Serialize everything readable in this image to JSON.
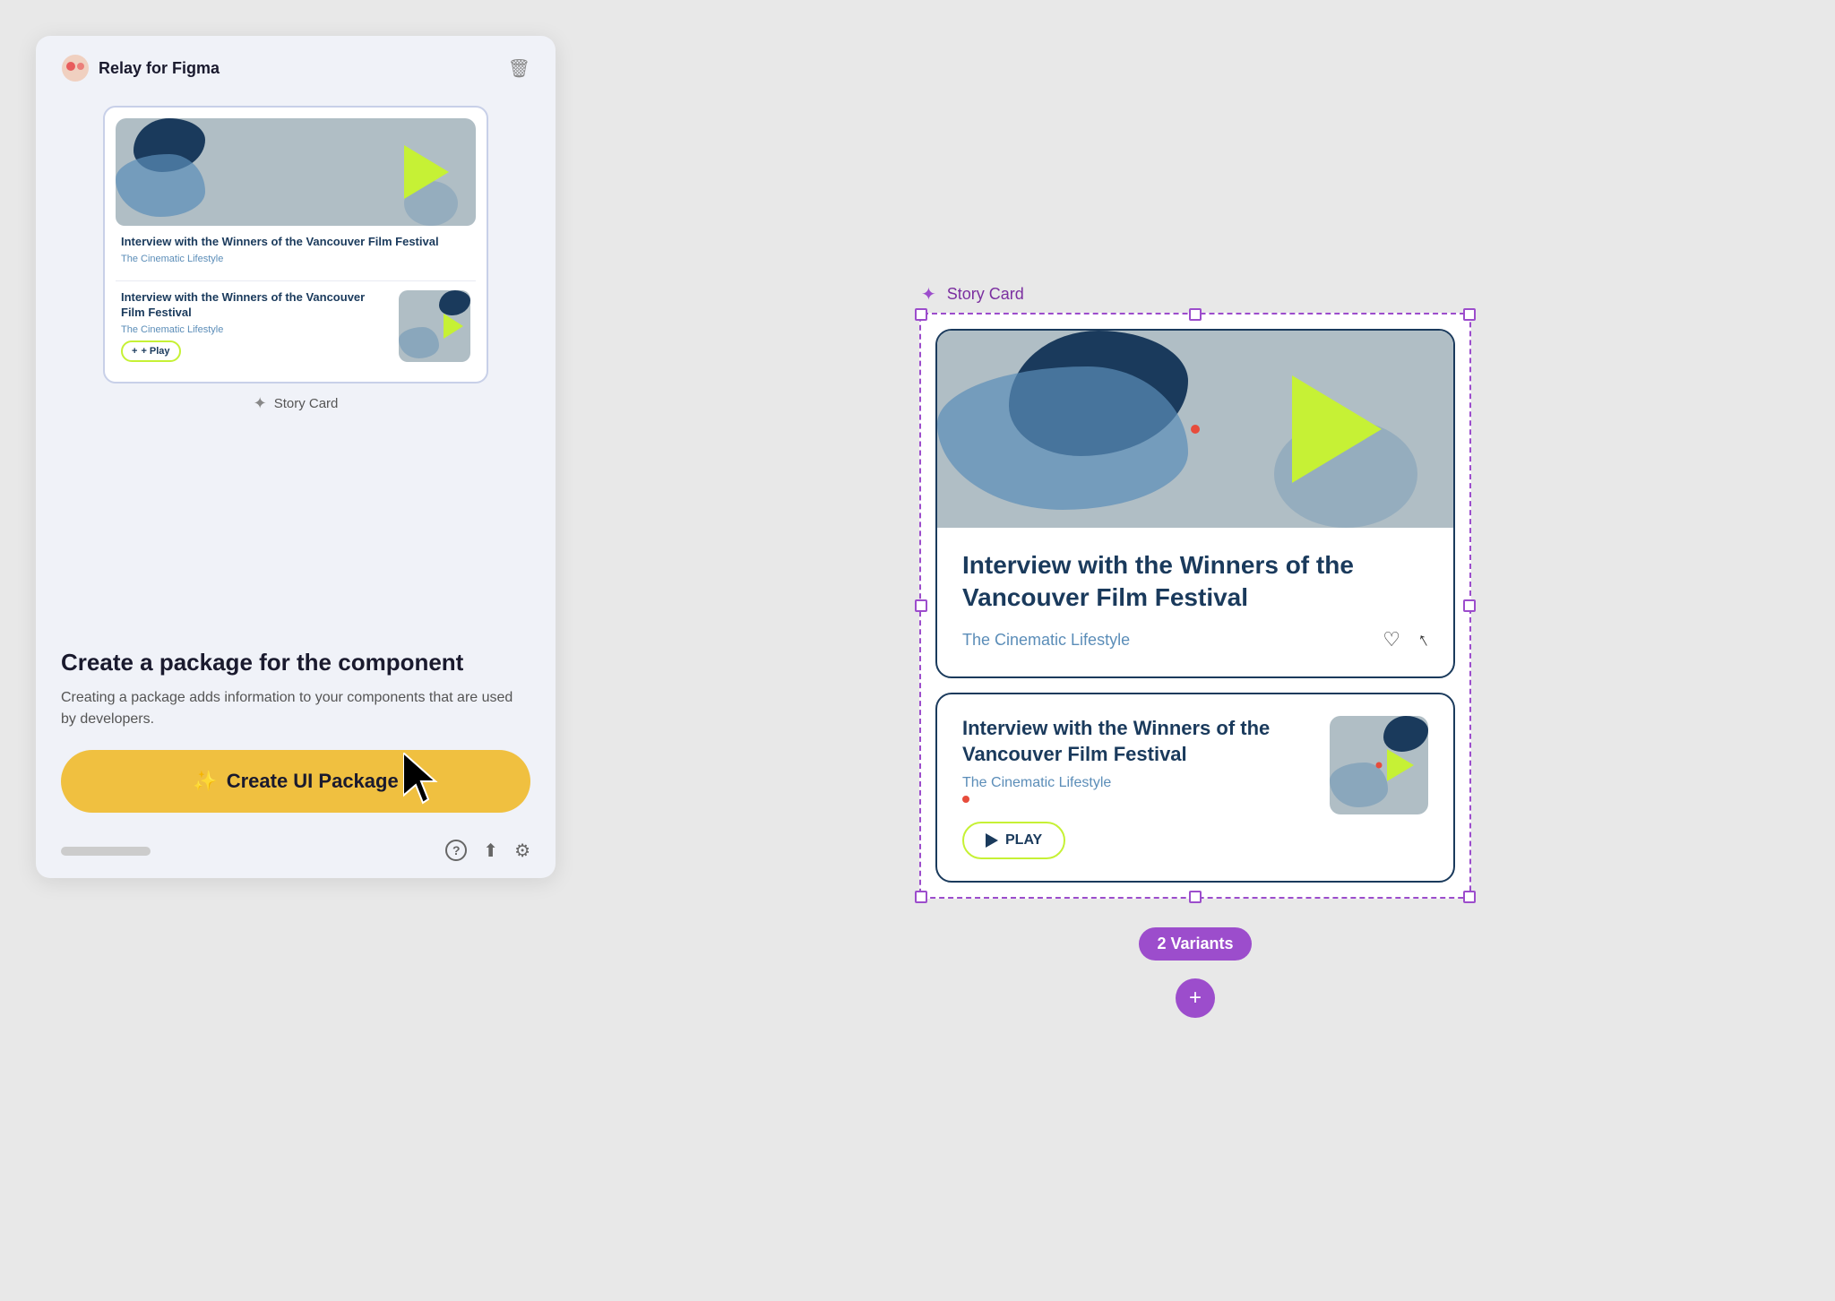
{
  "app": {
    "title": "Relay for Figma",
    "logo_color": "#e85c5c"
  },
  "left_panel": {
    "component_label": "Story Card",
    "create_title": "Create a package for the component",
    "create_desc": "Creating a package adds information to your components that are used by developers.",
    "create_btn_label": "Create UI Package",
    "create_btn_icon": "✨"
  },
  "story_cards": {
    "title": "Interview with the Winners of the Vancouver Film Festival",
    "title_short": "Interview with the Winners of the Vancouver Film Festival",
    "channel": "The Cinematic Lifestyle",
    "play_label": "PLAY",
    "play_label_sm": "+ Play",
    "like_icon": "♡",
    "share_icon": "⬆",
    "variants_badge": "2 Variants"
  },
  "footer": {
    "help_icon": "?",
    "share_icon": "share",
    "settings_icon": "settings"
  },
  "selection": {
    "label": "Story Card"
  }
}
